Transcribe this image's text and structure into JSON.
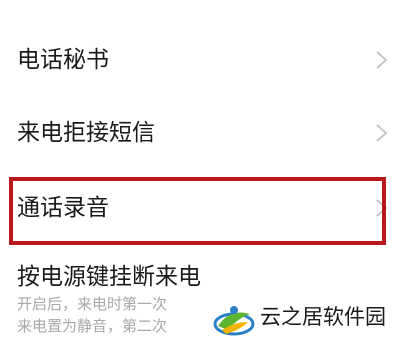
{
  "settings": {
    "items": [
      {
        "label": "电话秘书"
      },
      {
        "label": "来电拒接短信"
      },
      {
        "label": "通话录音"
      },
      {
        "label": "按电源键挂断来电"
      }
    ],
    "power_key_description": {
      "line1": "开启后，来电时第一次",
      "line2": "来电置为静音，第二次"
    }
  },
  "watermark": {
    "text": "云之居软件园"
  },
  "icons": {
    "chevron": "chevron-right-icon",
    "logo": "yunzhiju-logo-icon"
  },
  "colors": {
    "highlight_border": "#b8191c",
    "primary_text": "#1a1a1a",
    "secondary_text": "#a8a8a8",
    "chevron": "#c6c6c6"
  }
}
